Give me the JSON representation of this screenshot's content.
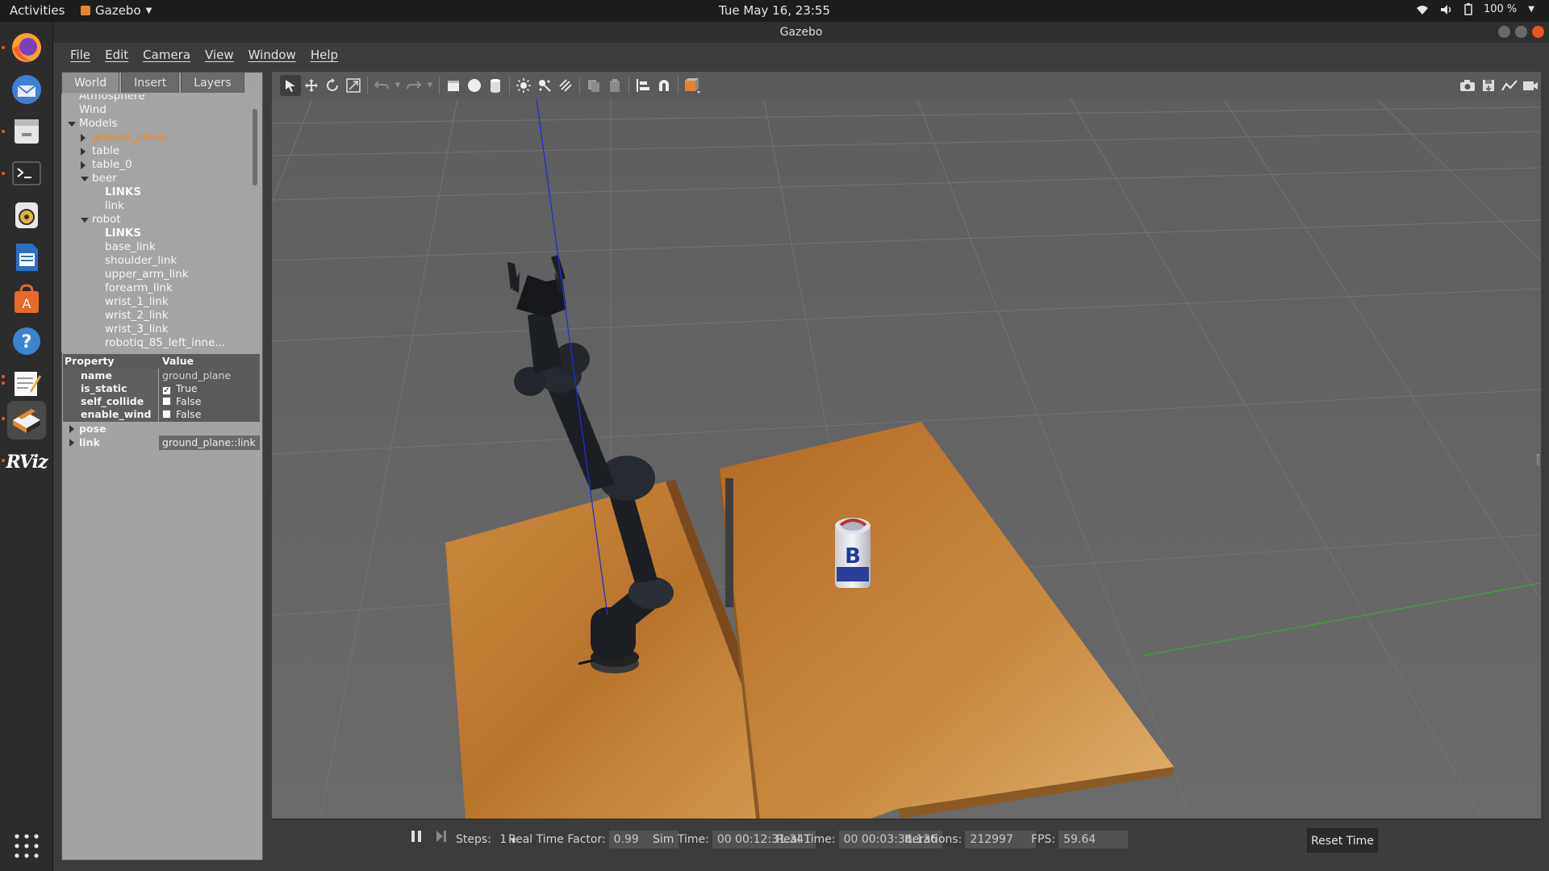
{
  "topbar": {
    "activities": "Activities",
    "app_name": "Gazebo",
    "datetime": "Tue May 16, 23:55",
    "battery": "100 %"
  },
  "dock": {
    "items": [
      "firefox-icon",
      "thunderbird-icon",
      "files-icon",
      "terminal-icon",
      "rhythmbox-icon",
      "writer-icon",
      "software-icon",
      "help-icon",
      "text-editor-icon",
      "gazebo-icon",
      "rviz-icon",
      "app-grid-icon"
    ],
    "rviz_label": "RViz"
  },
  "window": {
    "title": "Gazebo",
    "menu": [
      "File",
      "Edit",
      "Camera",
      "View",
      "Window",
      "Help"
    ]
  },
  "left_panel": {
    "tabs": [
      "World",
      "Insert",
      "Layers"
    ],
    "tree": [
      {
        "label": "Atmosphere",
        "level": 1,
        "arrow": "none",
        "highlight": false,
        "partial": true
      },
      {
        "label": "Wind",
        "level": 1,
        "arrow": "none",
        "highlight": false
      },
      {
        "label": "Models",
        "level": 1,
        "arrow": "down",
        "highlight": false
      },
      {
        "label": "ground_plane",
        "level": 2,
        "arrow": "right",
        "highlight": true
      },
      {
        "label": "table",
        "level": 2,
        "arrow": "right",
        "highlight": false
      },
      {
        "label": "table_0",
        "level": 2,
        "arrow": "right",
        "highlight": false
      },
      {
        "label": "beer",
        "level": 2,
        "arrow": "down",
        "highlight": false
      },
      {
        "label": "LINKS",
        "level": 3,
        "arrow": "none",
        "bold": true
      },
      {
        "label": "link",
        "level": 3,
        "arrow": "none"
      },
      {
        "label": "robot",
        "level": 2,
        "arrow": "down",
        "highlight": false
      },
      {
        "label": "LINKS",
        "level": 3,
        "arrow": "none",
        "bold": true
      },
      {
        "label": "base_link",
        "level": 3,
        "arrow": "none"
      },
      {
        "label": "shoulder_link",
        "level": 3,
        "arrow": "none"
      },
      {
        "label": "upper_arm_link",
        "level": 3,
        "arrow": "none"
      },
      {
        "label": "forearm_link",
        "level": 3,
        "arrow": "none"
      },
      {
        "label": "wrist_1_link",
        "level": 3,
        "arrow": "none"
      },
      {
        "label": "wrist_2_link",
        "level": 3,
        "arrow": "none"
      },
      {
        "label": "wrist_3_link",
        "level": 3,
        "arrow": "none"
      },
      {
        "label": "robotiq_85_left_inne...",
        "level": 3,
        "arrow": "none"
      }
    ],
    "properties": {
      "header_property": "Property",
      "header_value": "Value",
      "rows": [
        {
          "name": "name",
          "value": "ground_plane",
          "checkbox": null,
          "expand": false
        },
        {
          "name": "is_static",
          "value": "True",
          "checkbox": true,
          "expand": false
        },
        {
          "name": "self_collide",
          "value": "False",
          "checkbox": false,
          "expand": false
        },
        {
          "name": "enable_wind",
          "value": "False",
          "checkbox": false,
          "expand": false
        },
        {
          "name": "pose",
          "value": "",
          "checkbox": null,
          "expand": true
        },
        {
          "name": "link",
          "value": "ground_plane::link",
          "checkbox": null,
          "expand": true
        }
      ]
    }
  },
  "bottom_bar": {
    "steps_label": "Steps:",
    "steps_value": "1",
    "rtf_label": "Real Time Factor:",
    "rtf_value": "0.99",
    "sim_label": "Sim Time:",
    "sim_value": "00 00:12:31.341",
    "real_label": "Real Time:",
    "real_value": "00 00:03:36.136",
    "iter_label": "Iterations:",
    "iter_value": "212997",
    "fps_label": "FPS:",
    "fps_value": "59.64",
    "reset_label": "Reset Time"
  },
  "scene": {
    "can_letter": "B"
  },
  "colors": {
    "accent": "#e95420",
    "highlight_text": "#f08a2a"
  }
}
